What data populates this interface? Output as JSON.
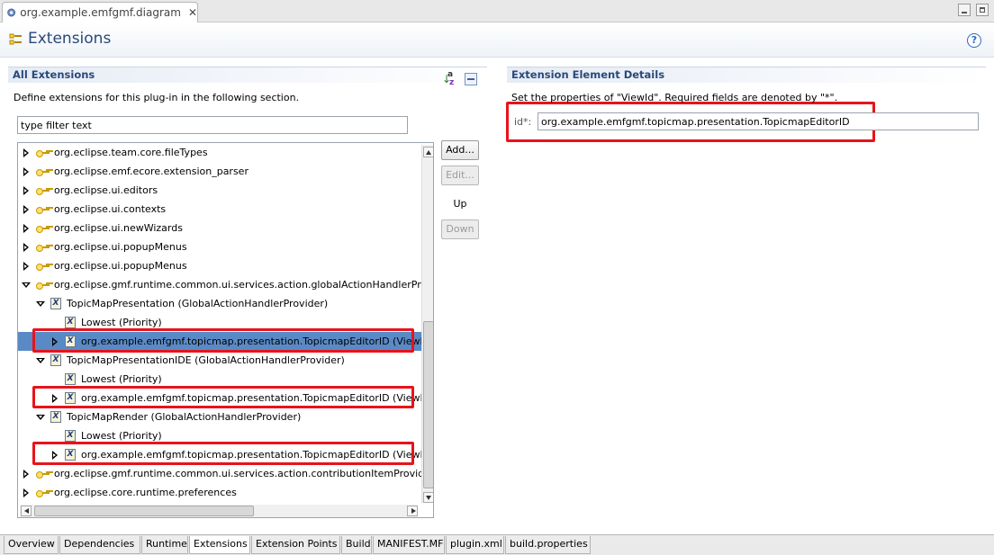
{
  "editor_tab": {
    "title": "org.example.emfgmf.diagram",
    "close": "✕"
  },
  "header": {
    "title": "Extensions",
    "help": "?"
  },
  "left": {
    "title": "All Extensions",
    "description": "Define extensions for this plug-in in the following section.",
    "filter_value": "type filter text",
    "tree": [
      {
        "text": "org.eclipse.team.core.fileTypes",
        "level": 0,
        "state": "collapsed",
        "icon": "extension-point-icon"
      },
      {
        "text": "org.eclipse.emf.ecore.extension_parser",
        "level": 0,
        "state": "collapsed",
        "icon": "extension-point-icon"
      },
      {
        "text": "org.eclipse.ui.editors",
        "level": 0,
        "state": "collapsed",
        "icon": "extension-point-icon"
      },
      {
        "text": "org.eclipse.ui.contexts",
        "level": 0,
        "state": "collapsed",
        "icon": "extension-point-icon"
      },
      {
        "text": "org.eclipse.ui.newWizards",
        "level": 0,
        "state": "collapsed",
        "icon": "extension-point-icon"
      },
      {
        "text": "org.eclipse.ui.popupMenus",
        "level": 0,
        "state": "collapsed",
        "icon": "extension-point-icon"
      },
      {
        "text": "org.eclipse.ui.popupMenus",
        "level": 0,
        "state": "collapsed",
        "icon": "extension-point-icon"
      },
      {
        "text": "org.eclipse.gmf.runtime.common.ui.services.action.globalActionHandlerProviders",
        "level": 0,
        "state": "expanded",
        "icon": "extension-point-icon"
      },
      {
        "text": "TopicMapPresentation (GlobalActionHandlerProvider)",
        "level": 1,
        "state": "expanded",
        "icon": "element-icon"
      },
      {
        "text": "Lowest (Priority)",
        "level": 2,
        "state": "none",
        "icon": "element-icon"
      },
      {
        "text": "org.example.emfgmf.topicmap.presentation.TopicmapEditorID (ViewId)",
        "level": 2,
        "state": "collapsed",
        "icon": "element-icon",
        "selected": true
      },
      {
        "text": "TopicMapPresentationIDE (GlobalActionHandlerProvider)",
        "level": 1,
        "state": "expanded",
        "icon": "element-icon"
      },
      {
        "text": "Lowest (Priority)",
        "level": 2,
        "state": "none",
        "icon": "element-icon"
      },
      {
        "text": "org.example.emfgmf.topicmap.presentation.TopicmapEditorID (ViewId)",
        "level": 2,
        "state": "collapsed",
        "icon": "element-icon"
      },
      {
        "text": "TopicMapRender (GlobalActionHandlerProvider)",
        "level": 1,
        "state": "expanded",
        "icon": "element-icon"
      },
      {
        "text": "Lowest (Priority)",
        "level": 2,
        "state": "none",
        "icon": "element-icon"
      },
      {
        "text": "org.example.emfgmf.topicmap.presentation.TopicmapEditorID (ViewId)",
        "level": 2,
        "state": "collapsed",
        "icon": "element-icon"
      },
      {
        "text": "org.eclipse.gmf.runtime.common.ui.services.action.contributionItemProviders",
        "level": 0,
        "state": "collapsed",
        "icon": "extension-point-icon"
      },
      {
        "text": "org.eclipse.core.runtime.preferences",
        "level": 0,
        "state": "collapsed",
        "icon": "extension-point-icon"
      }
    ],
    "buttons": {
      "add": "Add...",
      "edit": "Edit...",
      "up": "Up",
      "down": "Down"
    }
  },
  "right": {
    "title": "Extension Element Details",
    "description": "Set the properties of \"ViewId\". Required fields are denoted by \"*\".",
    "id_label": "id*:",
    "id_value": "org.example.emfgmf.topicmap.presentation.TopicmapEditorID"
  },
  "bottom_tabs": [
    {
      "label": "Overview",
      "active": false
    },
    {
      "label": "Dependencies",
      "active": false
    },
    {
      "label": "Runtime",
      "active": false
    },
    {
      "label": "Extensions",
      "active": true
    },
    {
      "label": "Extension Points",
      "active": false
    },
    {
      "label": "Build",
      "active": false
    },
    {
      "label": "MANIFEST.MF",
      "active": false
    },
    {
      "label": "plugin.xml",
      "active": false
    },
    {
      "label": "build.properties",
      "active": false
    }
  ],
  "colors": {
    "title": "#29497a",
    "selection": "#5a8ac6",
    "highlight": "#e8131b"
  }
}
